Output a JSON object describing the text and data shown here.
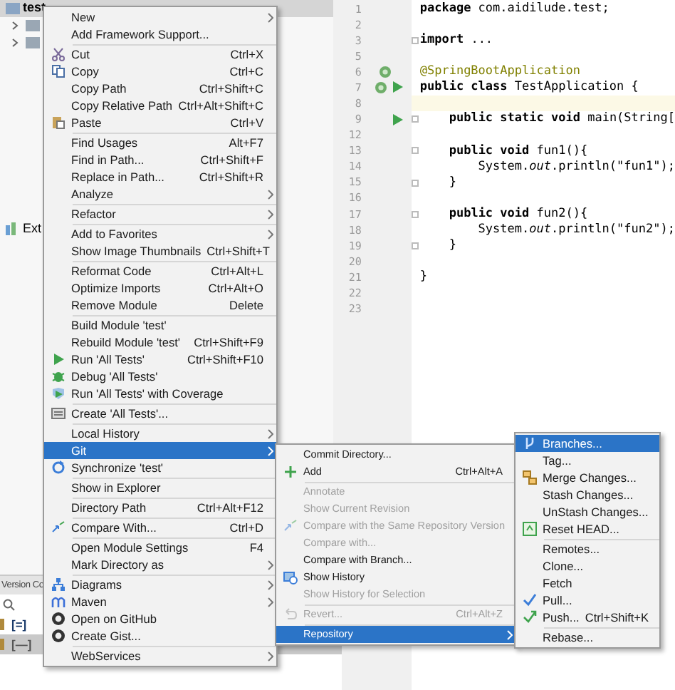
{
  "project": {
    "root": "test",
    "external": "Ext"
  },
  "version_control": {
    "title": "Version Co",
    "rows": [
      {
        "label": "[=]",
        "selected": false
      },
      {
        "label": "[—]",
        "selected": true
      }
    ]
  },
  "editor": {
    "lines": [
      {
        "number": "1",
        "code": "**package** com.aidilude.test;",
        "kind": "code",
        "highlighted": false,
        "fold": false
      },
      {
        "number": "2",
        "highlighted": false,
        "fold": false
      },
      {
        "number": "3",
        "code": "**import** ...",
        "kind": "code",
        "highlighted": false,
        "fold": true
      },
      {
        "number": "5",
        "highlighted": false,
        "fold": false
      },
      {
        "number": "6",
        "code": "@SpringBootApplication",
        "kind": "annotation",
        "highlighted": false,
        "fold": false
      },
      {
        "number": "7",
        "code": "**public class** TestApplication {",
        "kind": "code",
        "highlighted": false,
        "fold": false
      },
      {
        "number": "8",
        "highlighted": true,
        "fold": false
      },
      {
        "number": "9",
        "code": "    **public static void** main(String[",
        "kind": "code",
        "highlighted": false,
        "fold": true
      },
      {
        "number": "12",
        "highlighted": false,
        "fold": false
      },
      {
        "number": "13",
        "code": "    **public void** fun1(){",
        "kind": "code",
        "highlighted": false,
        "fold": true
      },
      {
        "number": "14",
        "code": "        System.*out*.println(\"fun1\");",
        "kind": "code",
        "highlighted": false,
        "fold": false
      },
      {
        "number": "15",
        "code": "    }",
        "kind": "code",
        "highlighted": false,
        "fold": true
      },
      {
        "number": "16",
        "highlighted": false,
        "fold": false
      },
      {
        "number": "17",
        "code": "    **public void** fun2(){",
        "kind": "code",
        "highlighted": false,
        "fold": true
      },
      {
        "number": "18",
        "code": "        System.*out*.println(\"fun2\");",
        "kind": "code",
        "highlighted": false,
        "fold": false
      },
      {
        "number": "19",
        "code": "    }",
        "kind": "code",
        "highlighted": false,
        "fold": true
      },
      {
        "number": "20",
        "highlighted": false,
        "fold": false
      },
      {
        "number": "21",
        "code": "}",
        "kind": "code",
        "highlighted": false,
        "fold": false
      },
      {
        "number": "22",
        "highlighted": false,
        "fold": false
      },
      {
        "number": "23",
        "highlighted": false,
        "fold": false
      }
    ]
  },
  "context_menu": [
    {
      "kind": "item",
      "label": "New",
      "submenu": true,
      "disabled": false,
      "selected": false
    },
    {
      "kind": "item",
      "label": "Add Framework Support...",
      "submenu": false,
      "disabled": false,
      "selected": false
    },
    {
      "kind": "separator"
    },
    {
      "kind": "item",
      "label": "Cut",
      "shortcut": "Ctrl+X",
      "submenu": false,
      "disabled": false,
      "selected": false
    },
    {
      "kind": "item",
      "label": "Copy",
      "shortcut": "Ctrl+C",
      "submenu": false,
      "disabled": false,
      "selected": false
    },
    {
      "kind": "item",
      "label": "Copy Path",
      "shortcut": "Ctrl+Shift+C",
      "submenu": false,
      "disabled": false,
      "selected": false
    },
    {
      "kind": "item",
      "label": "Copy Relative Path",
      "shortcut": "Ctrl+Alt+Shift+C",
      "submenu": false,
      "disabled": false,
      "selected": false
    },
    {
      "kind": "item",
      "label": "Paste",
      "shortcut": "Ctrl+V",
      "submenu": false,
      "disabled": false,
      "selected": false
    },
    {
      "kind": "separator"
    },
    {
      "kind": "item",
      "label": "Find Usages",
      "shortcut": "Alt+F7",
      "submenu": false,
      "disabled": false,
      "selected": false
    },
    {
      "kind": "item",
      "label": "Find in Path...",
      "shortcut": "Ctrl+Shift+F",
      "submenu": false,
      "disabled": false,
      "selected": false
    },
    {
      "kind": "item",
      "label": "Replace in Path...",
      "shortcut": "Ctrl+Shift+R",
      "submenu": false,
      "disabled": false,
      "selected": false
    },
    {
      "kind": "item",
      "label": "Analyze",
      "submenu": true,
      "disabled": false,
      "selected": false
    },
    {
      "kind": "separator"
    },
    {
      "kind": "item",
      "label": "Refactor",
      "submenu": true,
      "disabled": false,
      "selected": false
    },
    {
      "kind": "separator"
    },
    {
      "kind": "item",
      "label": "Add to Favorites",
      "submenu": true,
      "disabled": false,
      "selected": false
    },
    {
      "kind": "item",
      "label": "Show Image Thumbnails",
      "shortcut": "Ctrl+Shift+T",
      "submenu": false,
      "disabled": false,
      "selected": false
    },
    {
      "kind": "separator"
    },
    {
      "kind": "item",
      "label": "Reformat Code",
      "shortcut": "Ctrl+Alt+L",
      "submenu": false,
      "disabled": false,
      "selected": false
    },
    {
      "kind": "item",
      "label": "Optimize Imports",
      "shortcut": "Ctrl+Alt+O",
      "submenu": false,
      "disabled": false,
      "selected": false
    },
    {
      "kind": "item",
      "label": "Remove Module",
      "shortcut": "Delete",
      "submenu": false,
      "disabled": false,
      "selected": false
    },
    {
      "kind": "separator"
    },
    {
      "kind": "item",
      "label": "Build Module 'test'",
      "submenu": false,
      "disabled": false,
      "selected": false
    },
    {
      "kind": "item",
      "label": "Rebuild Module 'test'",
      "shortcut": "Ctrl+Shift+F9",
      "submenu": false,
      "disabled": false,
      "selected": false
    },
    {
      "kind": "item",
      "label": "Run 'All Tests'",
      "shortcut": "Ctrl+Shift+F10",
      "submenu": false,
      "disabled": false,
      "selected": false
    },
    {
      "kind": "item",
      "label": "Debug 'All Tests'",
      "submenu": false,
      "disabled": false,
      "selected": false
    },
    {
      "kind": "item",
      "label": "Run 'All Tests' with Coverage",
      "submenu": false,
      "disabled": false,
      "selected": false
    },
    {
      "kind": "separator"
    },
    {
      "kind": "item",
      "label": "Create 'All Tests'...",
      "submenu": false,
      "disabled": false,
      "selected": false
    },
    {
      "kind": "separator"
    },
    {
      "kind": "item",
      "label": "Local History",
      "submenu": true,
      "disabled": false,
      "selected": false
    },
    {
      "kind": "item",
      "label": "Git",
      "submenu": true,
      "disabled": false,
      "selected": true
    },
    {
      "kind": "item",
      "label": "Synchronize 'test'",
      "submenu": false,
      "disabled": false,
      "selected": false
    },
    {
      "kind": "separator"
    },
    {
      "kind": "item",
      "label": "Show in Explorer",
      "submenu": false,
      "disabled": false,
      "selected": false
    },
    {
      "kind": "separator"
    },
    {
      "kind": "item",
      "label": "Directory Path",
      "shortcut": "Ctrl+Alt+F12",
      "submenu": false,
      "disabled": false,
      "selected": false
    },
    {
      "kind": "separator"
    },
    {
      "kind": "item",
      "label": "Compare With...",
      "shortcut": "Ctrl+D",
      "submenu": false,
      "disabled": false,
      "selected": false
    },
    {
      "kind": "separator"
    },
    {
      "kind": "item",
      "label": "Open Module Settings",
      "shortcut": "F4",
      "submenu": false,
      "disabled": false,
      "selected": false
    },
    {
      "kind": "item",
      "label": "Mark Directory as",
      "submenu": true,
      "disabled": false,
      "selected": false
    },
    {
      "kind": "separator"
    },
    {
      "kind": "item",
      "label": "Diagrams",
      "submenu": true,
      "disabled": false,
      "selected": false
    },
    {
      "kind": "item",
      "label": "Maven",
      "submenu": true,
      "disabled": false,
      "selected": false
    },
    {
      "kind": "item",
      "label": "Open on GitHub",
      "submenu": false,
      "disabled": false,
      "selected": false
    },
    {
      "kind": "item",
      "label": "Create Gist...",
      "submenu": false,
      "disabled": false,
      "selected": false
    },
    {
      "kind": "separator"
    },
    {
      "kind": "item",
      "label": "WebServices",
      "submenu": true,
      "disabled": false,
      "selected": false
    }
  ],
  "git_menu": [
    {
      "kind": "item",
      "label": "Commit Directory...",
      "submenu": false,
      "disabled": false,
      "selected": false
    },
    {
      "kind": "item",
      "label": "Add",
      "shortcut": "Ctrl+Alt+A",
      "submenu": false,
      "disabled": false,
      "selected": false
    },
    {
      "kind": "separator"
    },
    {
      "kind": "item",
      "label": "Annotate",
      "submenu": false,
      "disabled": true,
      "selected": false
    },
    {
      "kind": "item",
      "label": "Show Current Revision",
      "submenu": false,
      "disabled": true,
      "selected": false
    },
    {
      "kind": "item",
      "label": "Compare with the Same Repository Version",
      "submenu": false,
      "disabled": true,
      "selected": false
    },
    {
      "kind": "item",
      "label": "Compare with...",
      "submenu": false,
      "disabled": true,
      "selected": false
    },
    {
      "kind": "item",
      "label": "Compare with Branch...",
      "submenu": false,
      "disabled": false,
      "selected": false
    },
    {
      "kind": "item",
      "label": "Show History",
      "submenu": false,
      "disabled": false,
      "selected": false
    },
    {
      "kind": "item",
      "label": "Show History for Selection",
      "submenu": false,
      "disabled": true,
      "selected": false
    },
    {
      "kind": "separator"
    },
    {
      "kind": "item",
      "label": "Revert...",
      "shortcut": "Ctrl+Alt+Z",
      "submenu": false,
      "disabled": true,
      "selected": false
    },
    {
      "kind": "separator"
    },
    {
      "kind": "item",
      "label": "Repository",
      "submenu": true,
      "disabled": false,
      "selected": true
    }
  ],
  "repository_menu": [
    {
      "kind": "item",
      "label": "Branches...",
      "submenu": false,
      "disabled": false,
      "selected": true
    },
    {
      "kind": "item",
      "label": "Tag...",
      "submenu": false,
      "disabled": false,
      "selected": false
    },
    {
      "kind": "item",
      "label": "Merge Changes...",
      "submenu": false,
      "disabled": false,
      "selected": false
    },
    {
      "kind": "item",
      "label": "Stash Changes...",
      "submenu": false,
      "disabled": false,
      "selected": false
    },
    {
      "kind": "item",
      "label": "UnStash Changes...",
      "submenu": false,
      "disabled": false,
      "selected": false
    },
    {
      "kind": "item",
      "label": "Reset HEAD...",
      "submenu": false,
      "disabled": false,
      "selected": false
    },
    {
      "kind": "separator"
    },
    {
      "kind": "item",
      "label": "Remotes...",
      "submenu": false,
      "disabled": false,
      "selected": false
    },
    {
      "kind": "item",
      "label": "Clone...",
      "submenu": false,
      "disabled": false,
      "selected": false
    },
    {
      "kind": "item",
      "label": "Fetch",
      "submenu": false,
      "disabled": false,
      "selected": false
    },
    {
      "kind": "item",
      "label": "Pull...",
      "submenu": false,
      "disabled": false,
      "selected": false
    },
    {
      "kind": "item",
      "label": "Push...",
      "shortcut": "Ctrl+Shift+K",
      "submenu": false,
      "disabled": false,
      "selected": false
    },
    {
      "kind": "separator"
    },
    {
      "kind": "item",
      "label": "Rebase...",
      "submenu": false,
      "disabled": false,
      "selected": false
    }
  ]
}
